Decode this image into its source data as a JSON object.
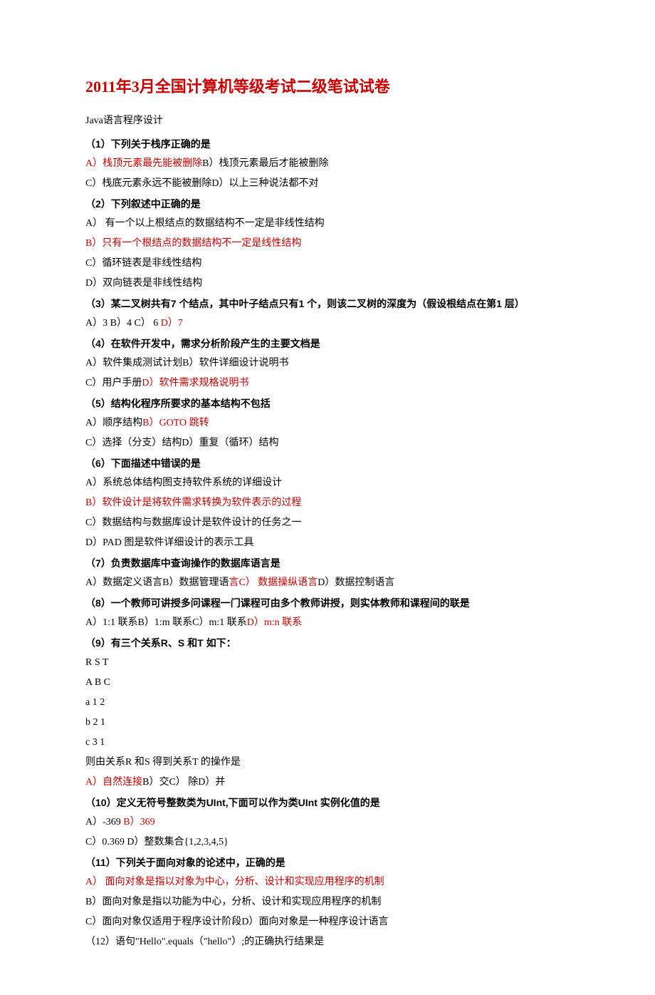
{
  "title": "2011年3月全国计算机等级考试二级笔试试卷",
  "subtitle": "Java语言程序设计",
  "q1": {
    "stem": "（1）下列关于栈序正确的是",
    "a": "A）栈顶元素最先能被删除",
    "b": "B）栈顶元素最后才能被删除",
    "c": "C）栈底元素永远不能被删除D）以上三种说法都不对"
  },
  "q2": {
    "stem": "（2）下列叙述中正确的是",
    "a": "A） 有一个以上根结点的数据结构不一定是非线性结构",
    "b": "B）只有一个根结点的数据结构不一定是线性结构",
    "c": "C）循环链表是非线性结构",
    "d": "D）双向链表是非线性结构"
  },
  "q3": {
    "stem": "（3）某二叉树共有7 个结点，其中叶子结点只有1 个，则该二叉树的深度为（假设根结点在第1 层）",
    "opts_pre": "A）3 B）4 C） 6 ",
    "opt_d": "D）7"
  },
  "q4": {
    "stem": "（4）在软件开发中，需求分析阶段产生的主要文档是",
    "line1": "A）软件集成测试计划B）软件详细设计说明书",
    "line2_pre": "C）用户手册",
    "line2_red": "D）软件需求规格说明书"
  },
  "q5": {
    "stem": "（5）结构化程序所要求的基本结构不包括",
    "line1_pre": "A）顺序结构",
    "line1_red": "B）GOTO 跳转",
    "line2": "C）选择（分支）结构D）重复（循环）结构"
  },
  "q6": {
    "stem": "（6）下面描述中错误的是",
    "a": "A）系统总体结构图支持软件系统的详细设计",
    "b": "B）软件设计是将软件需求转换为软件表示的过程",
    "c": "C）数据结构与数据库设计是软件设计的任务之一",
    "d": "D）PAD 图是软件详细设计的表示工具"
  },
  "q7": {
    "stem": "（7）负责数据库中查询操作的数据库语言是",
    "pre": "A）数据定义语言B）数据管理语",
    "red": "言C） 数据操纵语言",
    "post": "D）数据控制语言"
  },
  "q8": {
    "stem": "（8）一个教师可讲授多问课程一门课程可由多个教师讲授，则实体教师和课程间的联是",
    "pre": "A）1:1 联系B）1:m 联系C）m:1 联系",
    "red": "D）m:n 联系"
  },
  "q9": {
    "stem": "（9）有三个关系R、S 和T 如下：",
    "r1": "R S T",
    "r2": "A B C",
    "r3": "a 1 2",
    "r4": "b 2 1",
    "r5": "c 3 1",
    "r6": "则由关系R 和S 得到关系T 的操作是",
    "opt_red": "A）自然连接",
    "opt_post": "B）交C） 除D）并"
  },
  "q10": {
    "stem": "（10）定义无符号整数类为UInt,下面可以作为类UInt 实例化值的是",
    "line1_pre": "A）-369 ",
    "line1_red": "B）369",
    "line2": "C）0.369 D）整数集合{1,2,3,4,5}"
  },
  "q11": {
    "stem": "（11）下列关于面向对象的论述中，正确的是",
    "a": "A） 面向对象是指以对象为中心，分析、设计和实现应用程序的机制",
    "b": "B）面向对象是指以功能为中心，分析、设计和实现应用程序的机制",
    "c": "C）面向对象仅适用于程序设计阶段D）面向对象是一种程序设计语言"
  },
  "q12": {
    "stem": "（12）语句\"Hello\".equals（\"hello\"）;的正确执行结果是"
  }
}
